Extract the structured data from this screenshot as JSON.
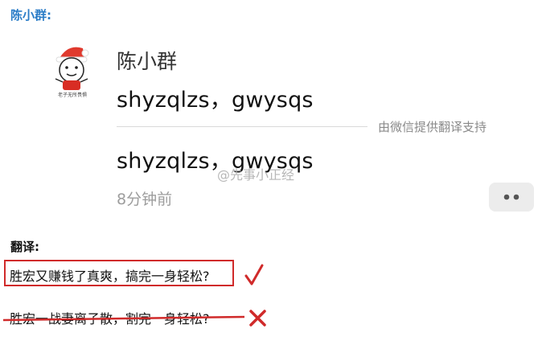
{
  "header": {
    "title": "陈小群:"
  },
  "message": {
    "avatar_icon": "cartoon-santa-hat-avatar-icon",
    "avatar_caption": "老子无所畏惧",
    "sender_name": "陈小群",
    "text": "shyzqlzs，gwysqs",
    "translation_note": "由微信提供翻译支持",
    "translated_text": "shyzqlzs，gwysqs",
    "timestamp": "8分钟前",
    "more_icon": "more-dots-icon"
  },
  "watermark": {
    "text": "@先事小正经"
  },
  "translation": {
    "heading": "翻译:",
    "correct": "胜宏又赚钱了真爽，搞完一身轻松?",
    "wrong": "胜宏一战妻离子散，割完一身轻松?",
    "correct_icon": "check-mark-icon",
    "wrong_icon": "cross-mark-icon"
  },
  "colors": {
    "title_blue": "#2a7cc7",
    "mark_red": "#d02a2a",
    "muted_gray": "#8a8a8a"
  }
}
